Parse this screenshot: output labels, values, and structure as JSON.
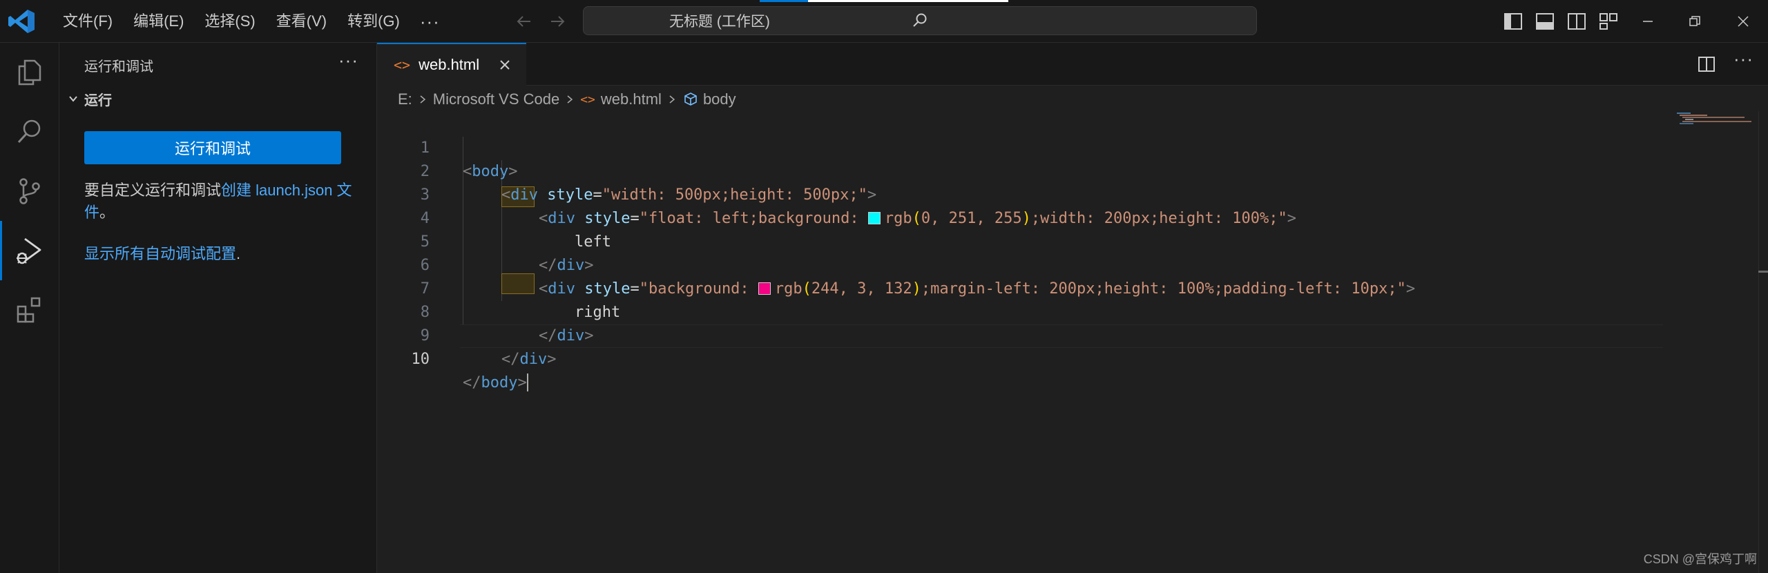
{
  "menu": [
    "文件(F)",
    "编辑(E)",
    "选择(S)",
    "查看(V)",
    "转到(G)"
  ],
  "menu_more": "···",
  "command_center": "无标题 (工作区)",
  "sidebar": {
    "title": "运行和调试",
    "more": "···",
    "section": "运行",
    "run_button": "运行和调试",
    "text_prefix": "要自定义运行和调试",
    "link_create": "创建 launch.json 文件",
    "text_suffix": "。",
    "link_show": "显示所有自动调试配置",
    "link_show_suffix": "."
  },
  "tab": {
    "icon": "<>",
    "label": "web.html"
  },
  "tab_more": "···",
  "breadcrumb": {
    "drive": "E:",
    "folder": "Microsoft VS Code",
    "file_icon": "<>",
    "file": "web.html",
    "symbol": "body"
  },
  "code": {
    "line_numbers": [
      "1",
      "2",
      "3",
      "4",
      "5",
      "6",
      "7",
      "8",
      "9",
      "10"
    ],
    "l1": {
      "open": "<",
      "tag": "body",
      "close": ">"
    },
    "l2": {
      "open": "<",
      "tag": "div",
      "attr": "style",
      "eq": "=",
      "value": "\"width: 500px;height: 500px;\"",
      "close": ">"
    },
    "l3": {
      "open": "<",
      "tag": "div",
      "attr": "style",
      "eq": "=",
      "v1": "\"float: left;background: ",
      "fn": "rgb",
      "lp": "(",
      "args": "0, 251, 255",
      "rp": ")",
      "v2": ";width: 200px;height: 100%;\"",
      "close": ">"
    },
    "l4": {
      "text": "left"
    },
    "l5": {
      "open": "</",
      "tag": "div",
      "close": ">"
    },
    "l6": {
      "open": "<",
      "tag": "div",
      "attr": "style",
      "eq": "=",
      "v1": "\"background: ",
      "fn": "rgb",
      "lp": "(",
      "args": "244, 3, 132",
      "rp": ")",
      "v2": ";margin-left: 200px;height: 100%;padding-left: 10px;\"",
      "close": ">"
    },
    "l7": {
      "text": "right"
    },
    "l8": {
      "open": "</",
      "tag": "div",
      "close": ">"
    },
    "l9": {
      "open": "</",
      "tag": "div",
      "close": ">"
    },
    "l10": {
      "open": "</",
      "tag": "body",
      "close": ">"
    }
  },
  "colors": {
    "swatch_cyan": "#00fbff",
    "swatch_pink": "#f40384",
    "accent": "#0078d4"
  },
  "icons": {
    "app": "vscode-logo-icon",
    "activity": [
      "explorer-icon",
      "search-icon",
      "source-control-icon",
      "run-debug-icon",
      "extensions-icon"
    ]
  },
  "watermark": "CSDN @宫保鸡丁啊"
}
